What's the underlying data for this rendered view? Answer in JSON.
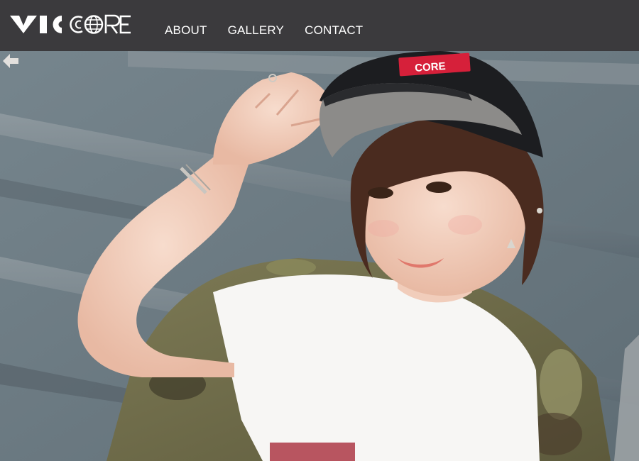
{
  "brand": {
    "name": "VICCORE",
    "cap_text": "CORE"
  },
  "nav": {
    "items": [
      {
        "label": "ABOUT"
      },
      {
        "label": "GALLERY"
      },
      {
        "label": "CONTACT"
      }
    ]
  },
  "colors": {
    "header_bg": "#3b3a3d",
    "nav_text": "#ffffff",
    "brand_red": "#d6203a"
  },
  "hero": {
    "prev_icon": "arrow-left-icon"
  }
}
